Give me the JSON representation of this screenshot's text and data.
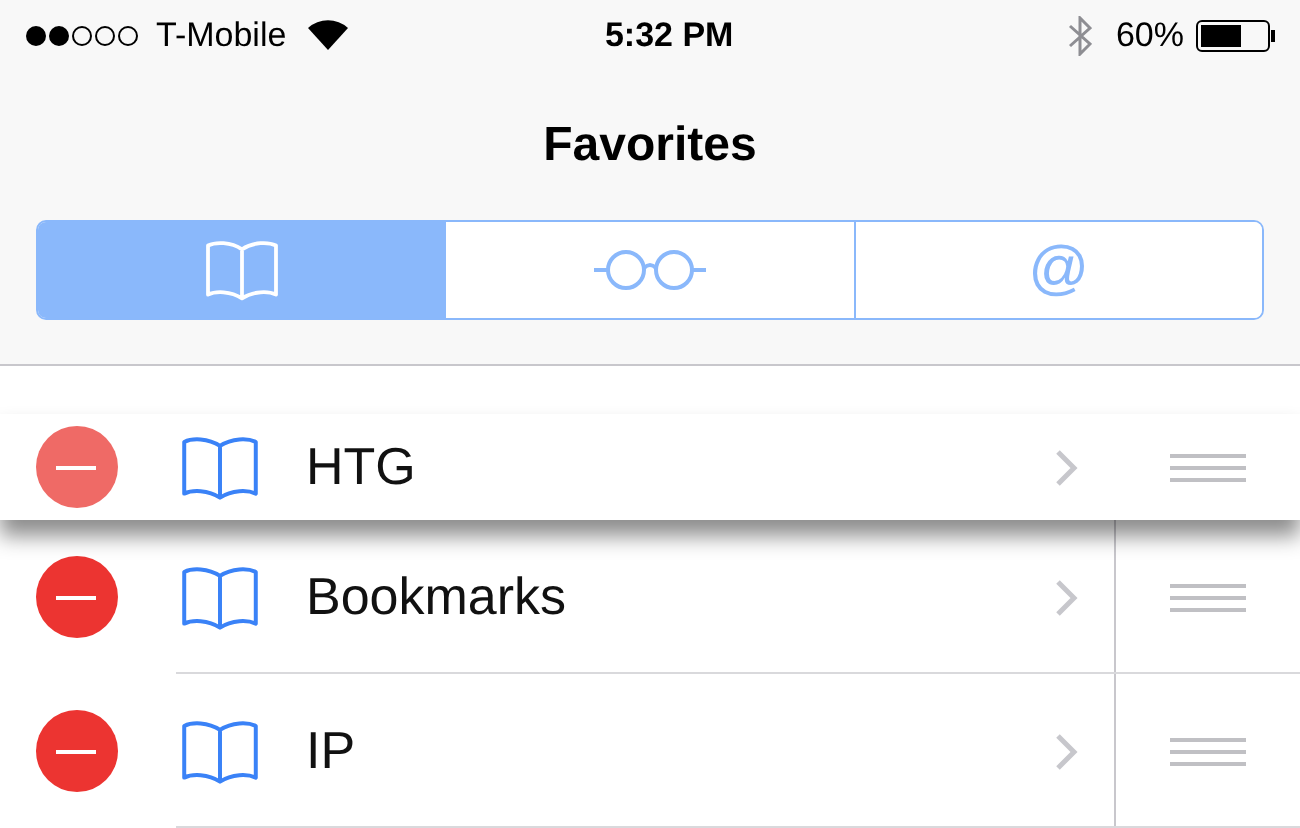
{
  "status_bar": {
    "carrier": "T-Mobile",
    "time": "5:32 PM",
    "battery": "60%"
  },
  "title": "Favorites",
  "segments": [
    {
      "kind": "book",
      "selected": true
    },
    {
      "kind": "glasses",
      "selected": false
    },
    {
      "kind": "at",
      "selected": false,
      "label": "@"
    }
  ],
  "rows": [
    {
      "name": "HTG",
      "dragging": true
    },
    {
      "name": "Bookmarks",
      "dragging": false
    },
    {
      "name": "IP",
      "dragging": false
    }
  ]
}
